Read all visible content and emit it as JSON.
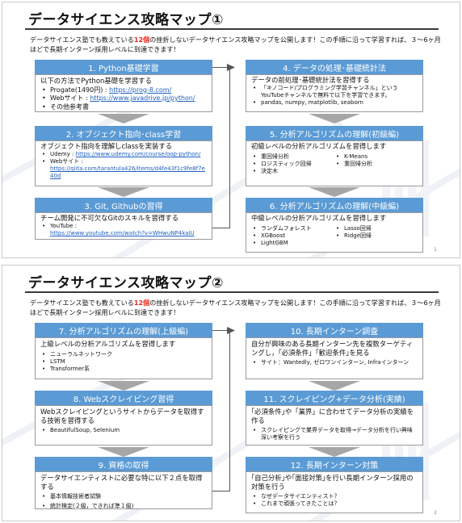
{
  "slide1": {
    "title": "データサイエンス攻略マップ①",
    "intro_pre": "データサイエンス塾でも教えている",
    "intro_highlight": "12個",
    "intro_post": "の挫折しないデータサイエンス攻略マップを公開します！この手順に沿って学習すれば、３～6ヶ月ほどで長期インターン採用レベルに到達できます！",
    "page": "1",
    "left": [
      {
        "title": "1. Python基礎学習",
        "lead": "以下の方法でPython基礎を学習する",
        "items": [
          {
            "text": "Progate(1490円) : ",
            "link": "https://prog-8.com/"
          },
          {
            "text": "Webサイト : ",
            "link": "https://www.javadrive.jp/python/"
          },
          {
            "text": "その他参考書",
            "link": ""
          }
        ]
      },
      {
        "title": "2. オブジェクト指向･class学習",
        "lead": "オブジェクト指向を理解しclassを実装する",
        "items": [
          {
            "text": "Udemy : ",
            "link": "https://www.udemy.com/course/oop-python/"
          },
          {
            "text": "Webサイト : ",
            "link": "https://qiita.com/tarantula426/items/d4fe43f1c9fe8f7e40d"
          }
        ]
      },
      {
        "title": "3. Git, Githubの習得",
        "lead": "チーム開発に不可欠なGitのスキルを習得する",
        "items": [
          {
            "text": "YouTube : ",
            "link": "https://www.youtube.com/watch?v=WHwuNP4kaIU"
          }
        ]
      }
    ],
    "right": [
      {
        "title": "4. データの処理･基礎統計法",
        "lead": "データの前処理･基礎統計法を習得する",
        "items": [
          {
            "text": "「キノコード/プログラミング学習チャンネル」というYouTubeチャンネルで無料で以下を学習できます。"
          },
          {
            "text": "pandas, numpy, matplotlib, seaborn"
          }
        ]
      },
      {
        "title": "5. 分析アルゴリズムの理解(初級編)",
        "lead": "初級レベルの分析アルゴリズムを習得します",
        "col1": [
          "重回帰分析",
          "ロジスティック回帰",
          "決定木"
        ],
        "col2": [
          "K-Means",
          "重回帰分析"
        ]
      },
      {
        "title": "6. 分析アルゴリズムの理解(中級編)",
        "lead": "中級レベルの分析アルゴリズムを習得します",
        "col1": [
          "ランダムフォレスト",
          "XGBoost",
          "LightGBM"
        ],
        "col2": [
          "Lasso回帰",
          "Ridge回帰"
        ]
      }
    ]
  },
  "slide2": {
    "title": "データサイエンス攻略マップ②",
    "intro_pre": "データサイエンス塾でも教えている",
    "intro_highlight": "12個",
    "intro_post": "の挫折しないデータサイエンス攻略マップを公開します！この手順に沿って学習すれば、３～6ヶ月ほどで長期インターン採用レベルに到達できます！",
    "page": "2",
    "left": [
      {
        "title": "7. 分析アルゴリズムの理解(上級編)",
        "lead": "上級レベルの分析アルゴリズムを習得します",
        "items": [
          "ニューラルネットワーク",
          "LSTM",
          "Transformer系"
        ]
      },
      {
        "title": "8. Webスクレイピング習得",
        "lead": "Webスクレイピングというサイトからデータを取得する技術を習得する",
        "items": [
          "BeautifulSoup, Selenium"
        ]
      },
      {
        "title": "9. 資格の取得",
        "lead": "データサイエンティストに必要な特に以下２点を取得する",
        "items": [
          "基本情報技術者試験",
          "統計検定(２級，できれば準１級)"
        ]
      }
    ],
    "right": [
      {
        "title": "10. 長期インターン調査",
        "lead": "自分が興味のある長期インターン先を複数ターゲティングし，「必須条件」｢歓迎条件｣を見る",
        "items": [
          "サイト：Wantedly, ゼロワンインターン, Infraインターン"
        ]
      },
      {
        "title": "11. スクレイピング+データ分析(実績)",
        "lead": "｢必須条件｣や「業界」に合わせてデータ分析の実績を作る",
        "items": [
          "スクレイピングで業界データを取得→データ分析を行い興味深い考察を行う"
        ]
      },
      {
        "title": "12. 長期インターン対策",
        "lead": "｢自己分析｣や｢面接対策｣を行い長期インターン採用の対策を行う",
        "items": [
          "なぜデータサイエンティスト？",
          "これまで頑張ってきたことは？"
        ]
      }
    ]
  }
}
